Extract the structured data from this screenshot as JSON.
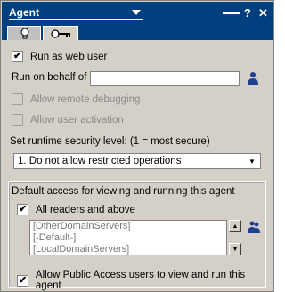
{
  "window": {
    "title": "Agent",
    "icons": [
      "help-icon",
      "close-icon"
    ]
  },
  "tabs": [
    {
      "name": "basics-tab",
      "icon": "lightbulb-icon"
    },
    {
      "name": "security-tab",
      "icon": "key-icon",
      "active": true
    }
  ],
  "form": {
    "run_as_web_user": {
      "label": "Run as web user",
      "checked": true
    },
    "run_on_behalf_label": "Run on behalf of",
    "run_on_behalf_value": "",
    "allow_remote_debugging": {
      "label": "Allow remote debugging",
      "checked": false,
      "disabled": true
    },
    "allow_user_activation": {
      "label": "Allow user activation",
      "checked": false,
      "disabled": true
    },
    "security_level_label": "Set runtime security level: (1 = most secure)",
    "security_level_value": "1. Do not allow restricted operations",
    "default_access_label": "Default access for viewing and running this agent",
    "all_readers": {
      "label": "All readers and above",
      "checked": true
    },
    "readers_list": [
      "[OtherDomainServers]",
      "[-Default-]",
      "[LocalDomainServers]"
    ],
    "allow_public_access": {
      "label": "Allow Public Access users to view and run this agent",
      "checked": true
    }
  },
  "colors": {
    "titlebar": "#003f7d",
    "panel": "#d4d0c8",
    "person_icon": "#1f3f8f"
  }
}
